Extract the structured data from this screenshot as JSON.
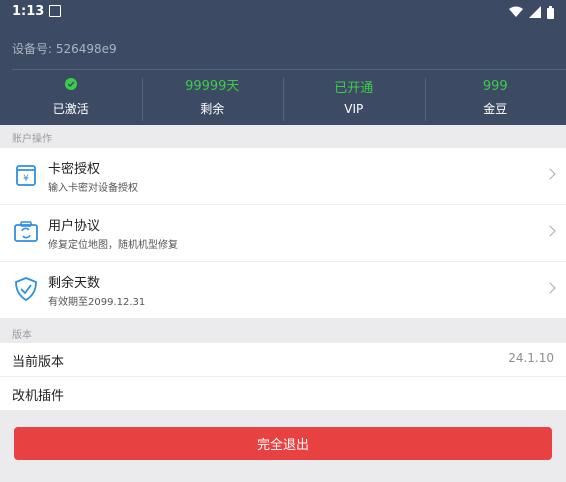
{
  "status_bar": {
    "time": "1:13"
  },
  "header": {
    "device_id": "设备号: 526498e9",
    "stats": [
      {
        "value": "",
        "label": "已激活",
        "icon": "check-circle-icon"
      },
      {
        "value": "99999天",
        "label": "剩余"
      },
      {
        "value": "已开通",
        "label": "VIP"
      },
      {
        "value": "999",
        "label": "金豆"
      }
    ]
  },
  "account_section": {
    "title": "账户操作",
    "items": [
      {
        "title": "卡密授权",
        "subtitle": "输入卡密对设备授权",
        "icon": "card-key-icon"
      },
      {
        "title": "用户协议",
        "subtitle": "修复定位地图，随机机型修复",
        "icon": "agreement-icon"
      },
      {
        "title": "剩余天数",
        "subtitle": "有效期至2099.12.31",
        "icon": "shield-check-icon"
      }
    ]
  },
  "version_section": {
    "title": "版本",
    "current_label": "当前版本",
    "current_value": "24.1.10",
    "plugin_label": "改机插件"
  },
  "exit_button": {
    "label": "完全退出"
  },
  "colors": {
    "header": "#3c4b63",
    "accent_green": "#3bcc4a",
    "icon_blue": "#2f8fe0",
    "danger": "#e84141"
  }
}
